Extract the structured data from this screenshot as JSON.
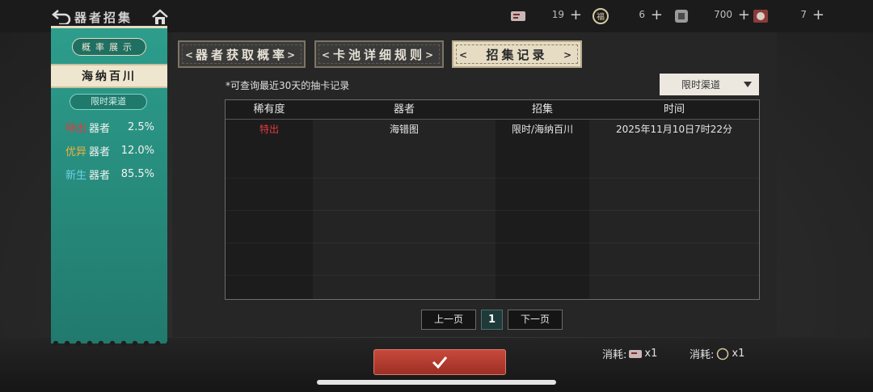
{
  "topbar": {
    "title": "器者招集",
    "resources": [
      {
        "icon": "ticket-icon",
        "count": "19",
        "plus": "+"
      },
      {
        "icon": "fortune-coin-icon",
        "count": "6",
        "plus": "+"
      },
      {
        "icon": "gold-coin-icon",
        "count": "700",
        "plus": "+"
      },
      {
        "icon": "gem-token-icon",
        "count": "7",
        "plus": "+"
      }
    ]
  },
  "left_panel": {
    "title": "概率展示",
    "pool_name": "海纳百川",
    "channel": "限时渠道",
    "rates": [
      {
        "tag": "特出",
        "suffix": "器者",
        "pct": "2.5%",
        "tag_color": "#e5393f"
      },
      {
        "tag": "优异",
        "suffix": "器者",
        "pct": "12.0%",
        "tag_color": "#e8a23a"
      },
      {
        "tag": "新生",
        "suffix": "器者",
        "pct": "85.5%",
        "tag_color": "#47b0c8"
      }
    ]
  },
  "tabs": [
    {
      "label": "器者获取概率",
      "active": false
    },
    {
      "label": "卡池详细规则",
      "active": false
    },
    {
      "label": "招集记录",
      "active": true
    }
  ],
  "record": {
    "note": "*可查询最近30天的抽卡记录",
    "filter": "限时渠道",
    "columns": [
      "稀有度",
      "器者",
      "招集",
      "时间"
    ],
    "rows": [
      {
        "rarity": "特出",
        "rarity_color": "#e5393f",
        "name": "海错图",
        "recruit": "限时/海纳百川",
        "time": "2025年11月10日7时22分"
      }
    ]
  },
  "pager": {
    "prev": "上一页",
    "page": "1",
    "next": "下一页"
  },
  "costs": [
    {
      "label": "消耗:",
      "icon": "ticket-icon",
      "amount": "x1"
    },
    {
      "label": "消耗:",
      "icon": "fortune-coin-icon",
      "amount": "x1"
    }
  ]
}
